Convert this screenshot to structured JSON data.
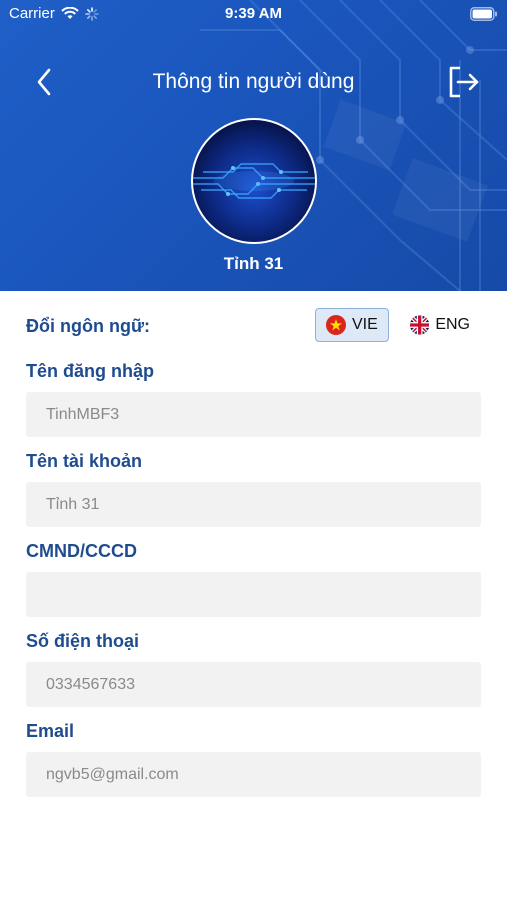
{
  "status_bar": {
    "carrier": "Carrier",
    "time": "9:39 AM"
  },
  "nav": {
    "title": "Thông tin người dùng",
    "back_icon": "chevron-left-icon",
    "logout_icon": "logout-icon"
  },
  "profile": {
    "name": "Tỉnh 31"
  },
  "language": {
    "label": "Đổi ngôn ngữ:",
    "options": [
      {
        "label": "VIE",
        "flag": "vietnam-flag-icon",
        "selected": true
      },
      {
        "label": "ENG",
        "flag": "uk-flag-icon",
        "selected": false
      }
    ]
  },
  "fields": [
    {
      "label": "Tên đăng nhập",
      "value": "TinhMBF3"
    },
    {
      "label": "Tên tài khoản",
      "value": "Tỉnh 31"
    },
    {
      "label": "CMND/CCCD",
      "value": ""
    },
    {
      "label": "Số điện thoại",
      "value": "0334567633"
    },
    {
      "label": "Email",
      "value": "ngvb5@gmail.com"
    }
  ],
  "colors": {
    "header_blue": "#1a56bd",
    "label_blue": "#1f4c8f",
    "input_bg": "#f2f2f2"
  }
}
